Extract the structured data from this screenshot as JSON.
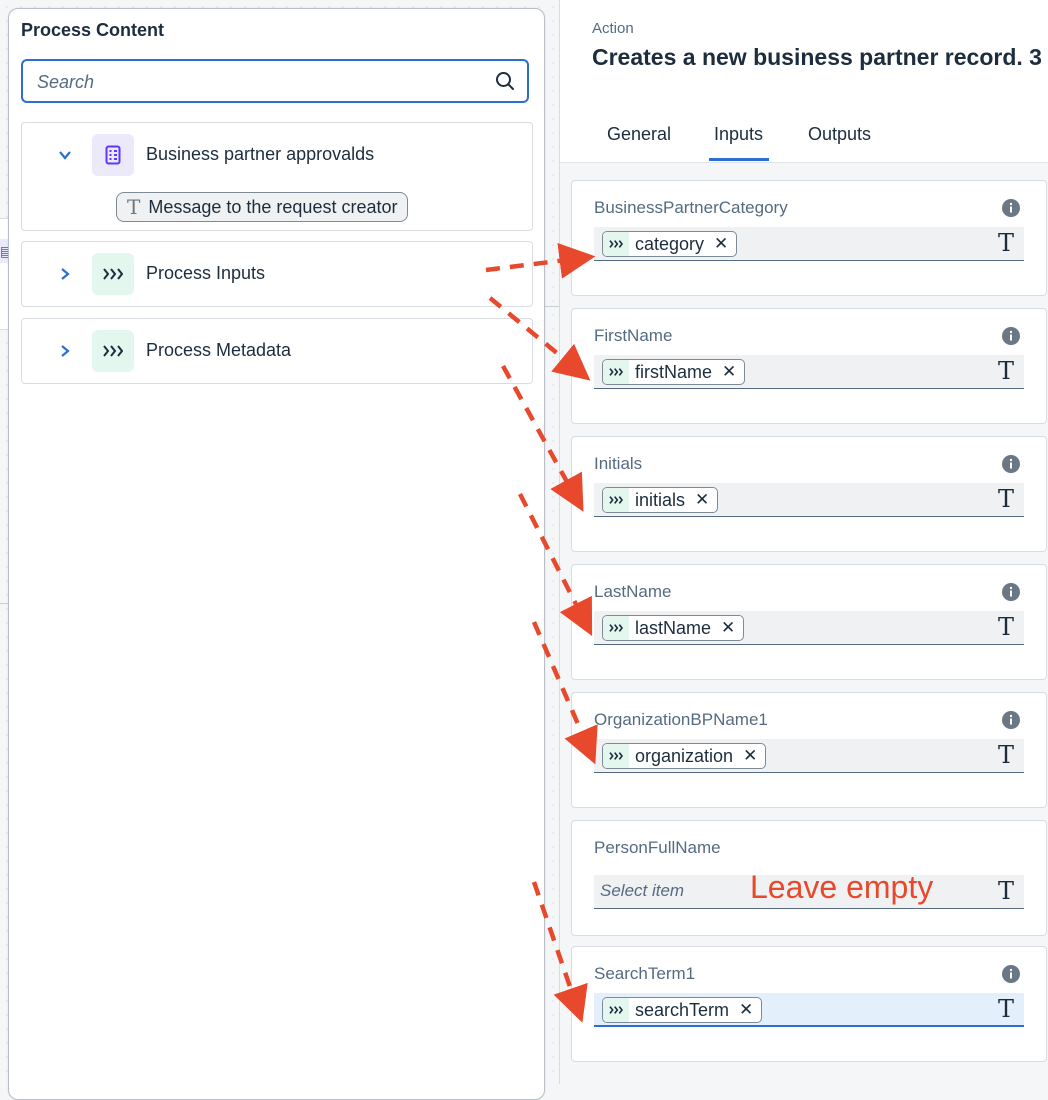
{
  "left_panel": {
    "title": "Process Content",
    "search": {
      "placeholder": "Search",
      "value": ""
    },
    "tree": [
      {
        "label": "Business partner approvalds",
        "icon": "form-icon",
        "expanded": true,
        "children": [
          {
            "label": "Message to the request creator",
            "icon": "text-type-icon"
          }
        ]
      },
      {
        "label": "Process Inputs",
        "icon": "process-input-icon",
        "expanded": false
      },
      {
        "label": "Process Metadata",
        "icon": "process-input-icon",
        "expanded": false
      }
    ]
  },
  "right_panel": {
    "header_label": "Action",
    "title": "Creates a new business partner record. 3",
    "tabs": [
      "General",
      "Inputs",
      "Outputs"
    ],
    "active_tab": "Inputs",
    "fields": [
      {
        "label": "BusinessPartnerCategory",
        "token": "category",
        "info": true
      },
      {
        "label": "FirstName",
        "token": "firstName",
        "info": true
      },
      {
        "label": "Initials",
        "token": "initials",
        "info": true
      },
      {
        "label": "LastName",
        "token": "lastName",
        "info": true
      },
      {
        "label": "OrganizationBPName1",
        "token": "organization",
        "info": true
      },
      {
        "label": "PersonFullName",
        "placeholder": "Select item",
        "info": false
      },
      {
        "label": "SearchTerm1",
        "token": "searchTerm",
        "info": true,
        "focused": true
      }
    ],
    "type_glyph": "T",
    "token_close": "✕"
  },
  "annotation": {
    "text": "Leave empty",
    "color": "#e8482c"
  },
  "colors": {
    "accent": "#2b6fd0",
    "arrow": "#e8482c",
    "token_icon_bg": "#e4f7ef",
    "form_icon_bg": "#ece9fb"
  }
}
